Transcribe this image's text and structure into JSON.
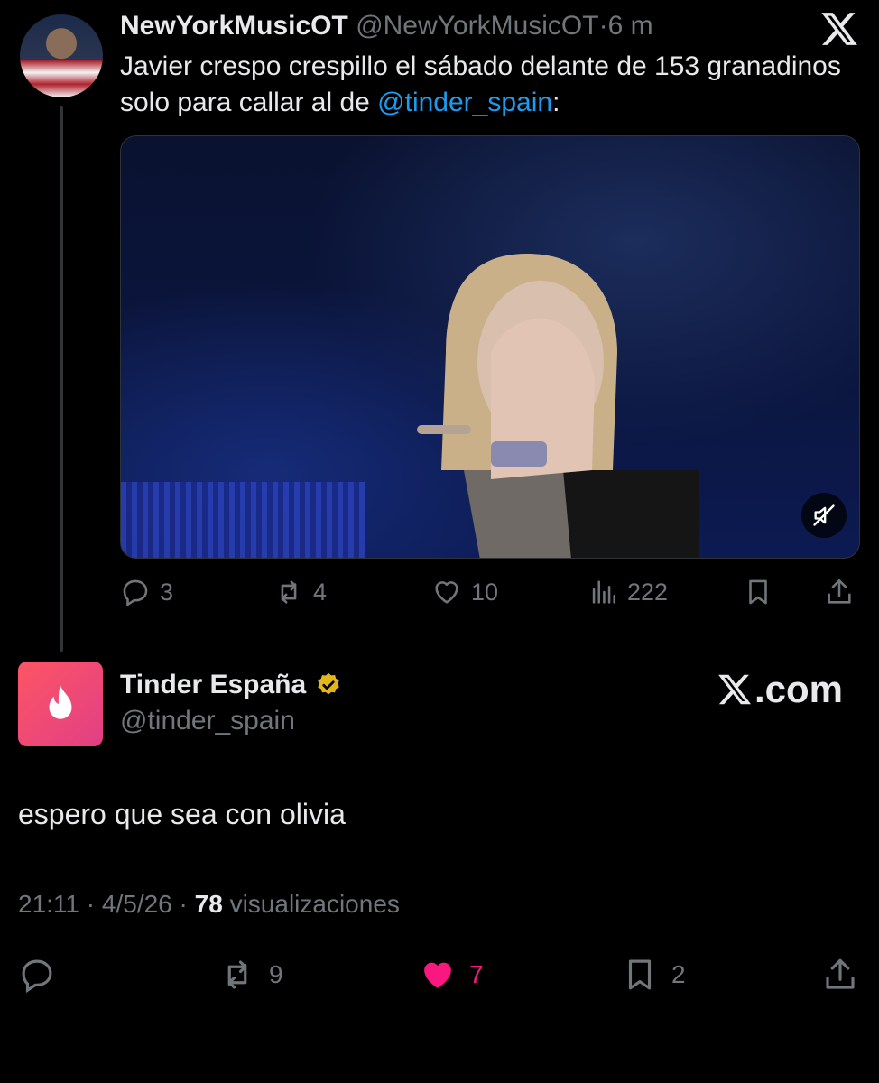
{
  "tweet1": {
    "author_name": "NewYorkMusicOT",
    "author_handle": "@NewYorkMusicOT",
    "separator": "·",
    "time": "6 m",
    "text_before": "Javier crespo crespillo el sábado delante de 153 granadinos solo para callar al de ",
    "mention": "@tinder_spain",
    "text_after": ":",
    "stats": {
      "replies": "3",
      "reposts": "4",
      "likes": "10",
      "views": "222"
    }
  },
  "tweet2": {
    "author_name": "Tinder España",
    "author_handle": "@tinder_spain",
    "brand_text": ".com",
    "text": "espero que sea con olivia",
    "time": "21:11",
    "date": "4/5/26",
    "views_count": "78",
    "views_label": "visualizaciones",
    "stats": {
      "reposts": "9",
      "likes": "7",
      "bookmarks": "2"
    }
  },
  "colors": {
    "background": "#000000",
    "text": "#e7e9ea",
    "muted": "#71767b",
    "mention": "#1d9bf0",
    "like": "#f91880",
    "verified_gold": "#e2b719"
  },
  "icons": {
    "top_right": "x-logo-icon",
    "media_control": "muted-speaker-icon",
    "tinder_logo": "flame-icon",
    "verified": "verified-badge-icon"
  }
}
